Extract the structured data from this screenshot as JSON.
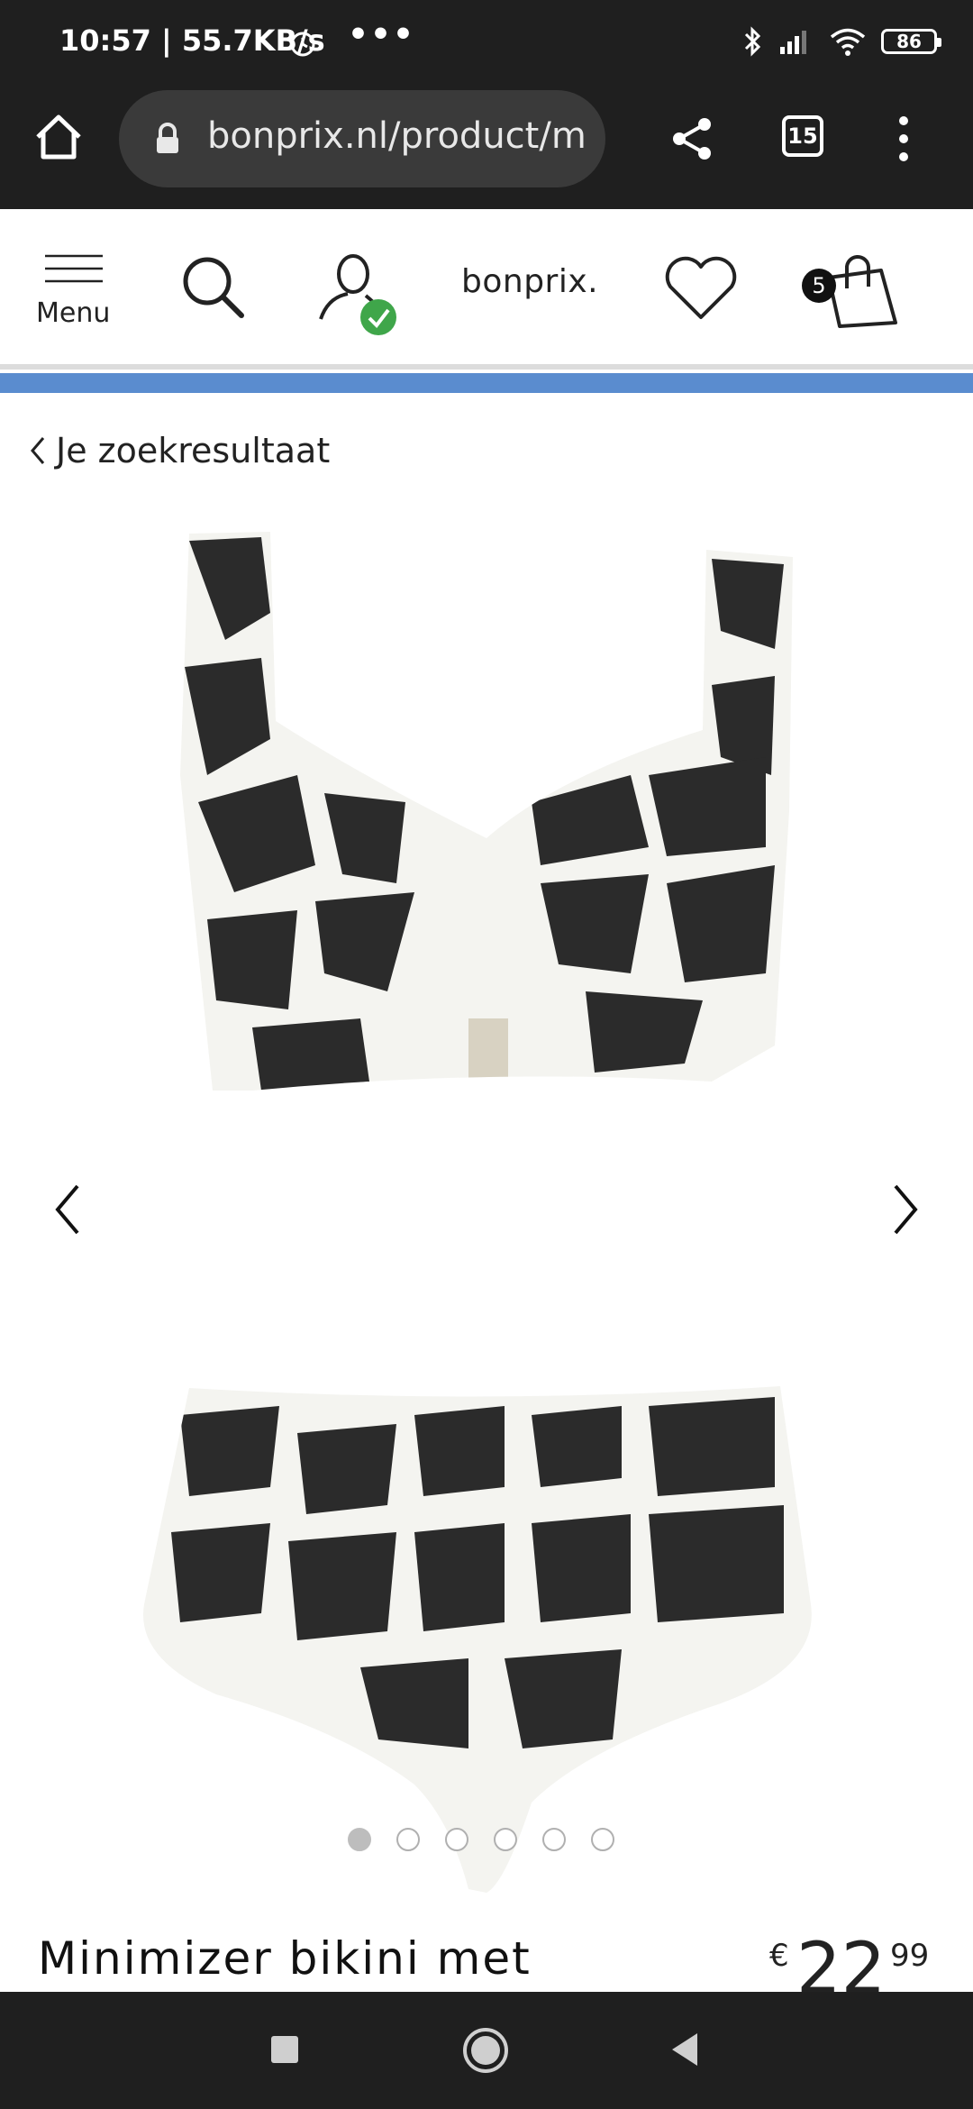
{
  "status": {
    "time": "10:57 | 55.7KB/s",
    "more": "•••",
    "battery": "86"
  },
  "browser": {
    "url": "bonprix.nl/product/m",
    "tab_count": "15"
  },
  "header": {
    "menu_label": "Menu",
    "logo": "bonprix.",
    "cart_count": "5"
  },
  "nav": {
    "back_label": "Je zoekresultaat"
  },
  "carousel": {
    "slides": 6,
    "active_index": 0
  },
  "product": {
    "title": "Minimizer bikini met",
    "price_currency": "€",
    "price_main": "22",
    "price_cents": "99"
  },
  "colors": {
    "bar": "#1f1f1f",
    "accent_blue": "#5a8ccf",
    "check_green": "#3fa64a"
  }
}
